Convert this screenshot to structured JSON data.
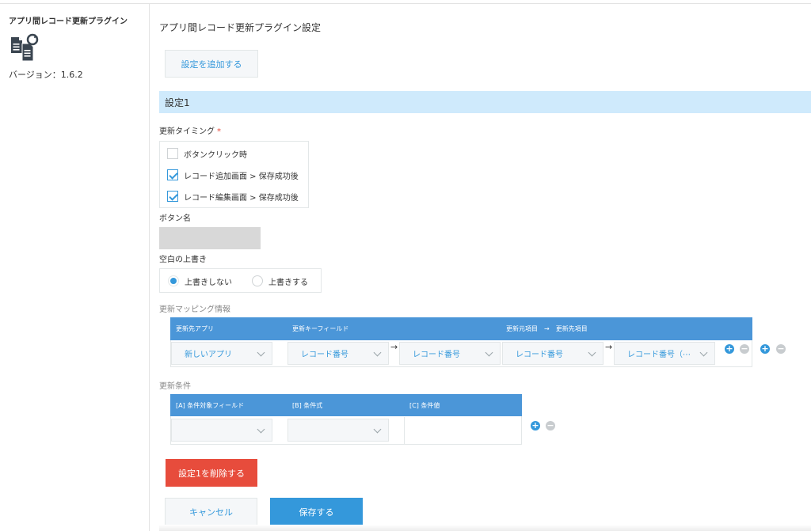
{
  "sidebar": {
    "plugin_name": "アプリ間レコード更新プラグイン",
    "version": "バージョン：1.6.2",
    "icon": "documents-refresh-icon"
  },
  "main": {
    "page_title": "アプリ間レコード更新プラグイン設定",
    "add_setting_label": "設定を追加する",
    "section_title": "設定1",
    "timing": {
      "label": "更新タイミング",
      "required_mark": "*",
      "options": [
        {
          "label": "ボタンクリック時",
          "checked": false
        },
        {
          "label": "レコード追加画面 > 保存成功後",
          "checked": true
        },
        {
          "label": "レコード編集画面 > 保存成功後",
          "checked": true
        }
      ]
    },
    "button_name": {
      "label": "ボタン名",
      "value": ""
    },
    "overwrite_blank": {
      "label": "空白の上書き",
      "options": [
        {
          "label": "上書きしない",
          "selected": true
        },
        {
          "label": "上書きする",
          "selected": false
        }
      ]
    },
    "mapping": {
      "label": "更新マッピング情報",
      "headers": {
        "target_app": "更新先アプリ",
        "key_field": "更新キーフィールド",
        "source_target": "更新元項目　→　更新先項目"
      },
      "row": {
        "target_app": "新しいアプリ",
        "key_source": "レコード番号",
        "key_target": "レコード番号",
        "field_source": "レコード番号",
        "field_target": "レコード番号（⋯"
      },
      "arrow": "→"
    },
    "conditions": {
      "label": "更新条件",
      "headers": {
        "field": "[A] 条件対象フィールド",
        "expression": "[B] 条件式",
        "value": "[C] 条件値"
      },
      "row": {
        "field": "",
        "expression": "",
        "value": ""
      }
    },
    "delete_label": "設定1を削除する",
    "cancel_label": "キャンセル",
    "save_label": "保存する",
    "colors": {
      "accent": "#3498db",
      "header_blue": "#4b96d8",
      "danger": "#e74c3c",
      "section_bg": "#cfeafc"
    }
  }
}
